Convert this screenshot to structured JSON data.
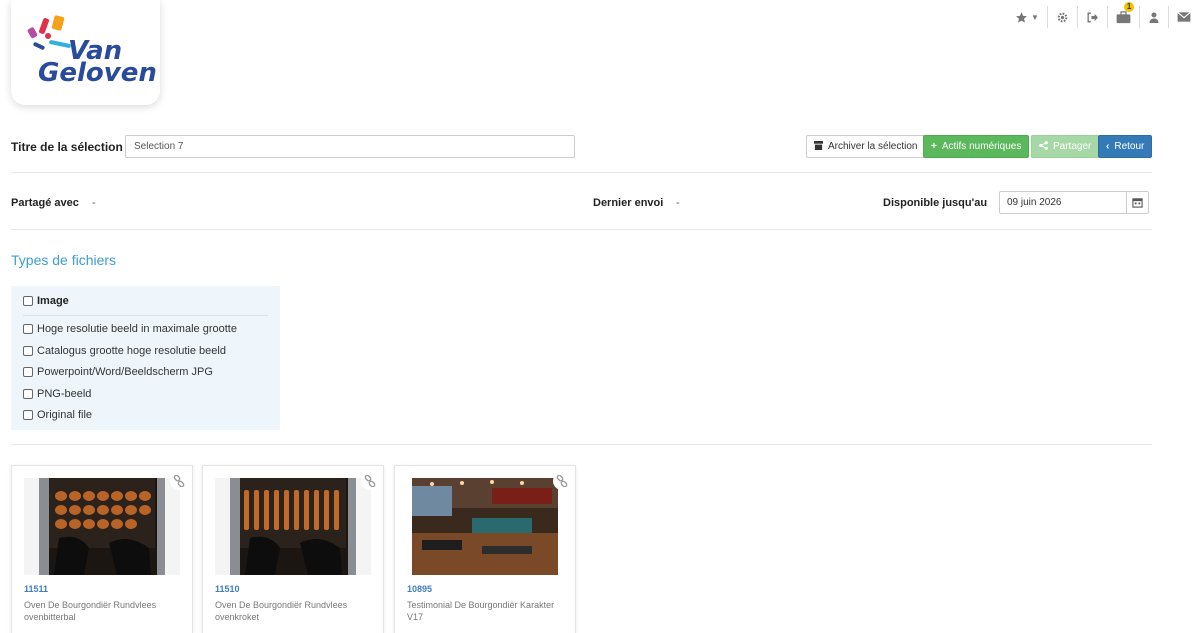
{
  "brand": {
    "name_line1": "Van",
    "name_line2": "Geloven",
    "color": "#2a4a9c"
  },
  "toolbar": {
    "items": [
      {
        "icon": "star-icon",
        "has_caret": true
      },
      {
        "icon": "gear-icon"
      },
      {
        "icon": "logout-icon"
      },
      {
        "icon": "briefcase-icon",
        "badge": "1"
      },
      {
        "icon": "user-icon"
      },
      {
        "icon": "envelope-icon"
      }
    ]
  },
  "selection": {
    "title_label": "Titre de la sélection",
    "title_value": "Selection 7",
    "buttons": {
      "archive": "Archiver la sélection",
      "digital_assets": "Actifs numériques",
      "share": "Partager",
      "back": "Retour"
    }
  },
  "meta": {
    "shared_with_label": "Partagé avec",
    "shared_with_value": "-",
    "last_sent_label": "Dernier envoi",
    "last_sent_value": "-",
    "available_until_label": "Disponible jusqu'au",
    "available_until_value": "09 juin 2026"
  },
  "file_types": {
    "section_title": "Types de fichiers",
    "group_label": "Image",
    "options": [
      "Hoge resolutie beeld in maximale grootte",
      "Catalogus grootte hoge resolutie beeld",
      "Powerpoint/Word/Beeldscherm JPG",
      "PNG-beeld",
      "Original file"
    ]
  },
  "assets": [
    {
      "id": "11511",
      "title": "Oven De Bourgondiër Rundvlees ovenbitterbal",
      "image": "oven-photo"
    },
    {
      "id": "11510",
      "title": "Oven De Bourgondiër Rundvlees ovenkroket",
      "image": "oven-photo"
    },
    {
      "id": "10895",
      "title": "Testimonial De Bourgondiër Karakter V17",
      "image": "restaurant-photo"
    }
  ],
  "colors": {
    "accent_blue": "#3d9dd4",
    "green": "#5cb85c",
    "primary": "#337ab7"
  }
}
